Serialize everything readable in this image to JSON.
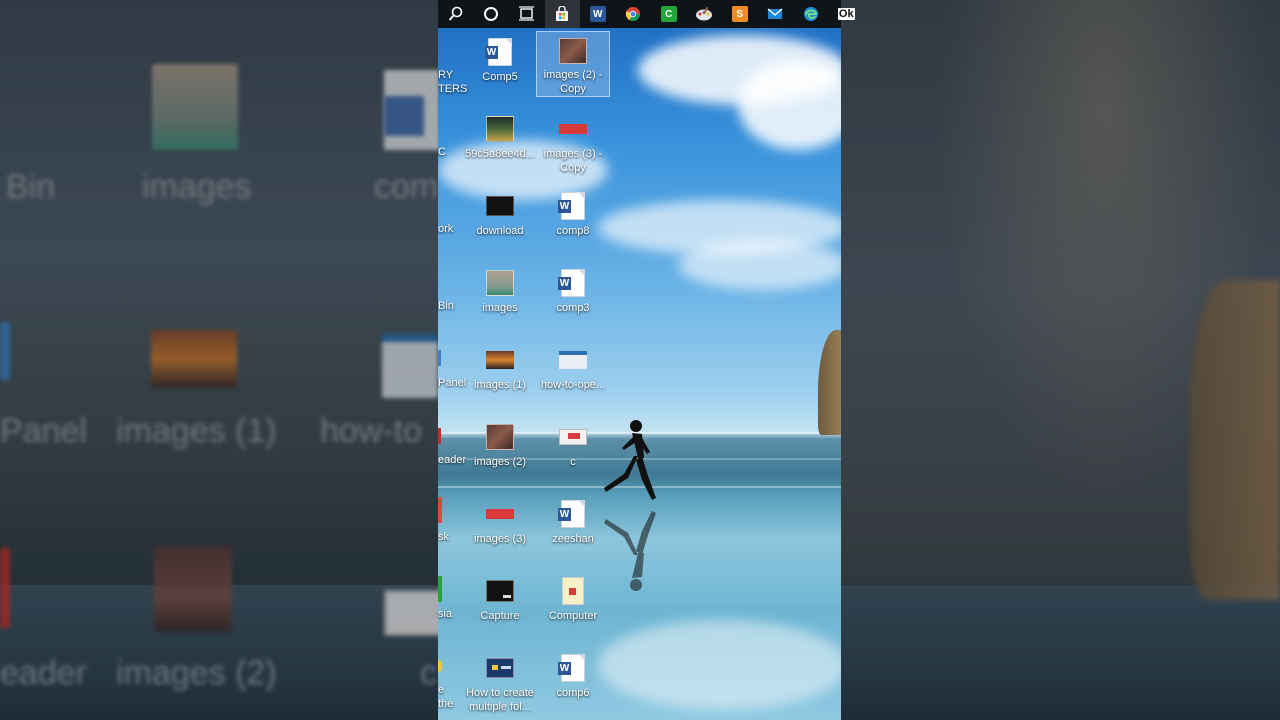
{
  "taskbar": {
    "items": [
      {
        "name": "search"
      },
      {
        "name": "cortana"
      },
      {
        "name": "task-view"
      },
      {
        "name": "store",
        "active": true
      },
      {
        "name": "word"
      },
      {
        "name": "chrome"
      },
      {
        "name": "camtasia"
      },
      {
        "name": "paint"
      },
      {
        "name": "sublime"
      },
      {
        "name": "mail"
      },
      {
        "name": "edge"
      },
      {
        "name": "ok-app",
        "label": "Ok"
      }
    ]
  },
  "desktop": {
    "partial_labels": {
      "row1": "RY\nTERS",
      "row2": "C",
      "row3": "ork",
      "row4": "Bin",
      "row5": "Panel",
      "row6": "eader",
      "row7": "sk",
      "row8": "sia",
      "row9": "e\nthe"
    },
    "icons": [
      {
        "label": "Comp5",
        "kind": "word"
      },
      {
        "label": "images (2) -\nCopy",
        "kind": "photo",
        "selected": true
      },
      {
        "label": "59c5a8ee4d...",
        "kind": "photo"
      },
      {
        "label": "images (3) -\nCopy",
        "kind": "redbar"
      },
      {
        "label": "download",
        "kind": "dark"
      },
      {
        "label": "comp8",
        "kind": "word"
      },
      {
        "label": "images",
        "kind": "photo"
      },
      {
        "label": "comp3",
        "kind": "word"
      },
      {
        "label": "images (1)",
        "kind": "sunset"
      },
      {
        "label": "how-to-ope...",
        "kind": "window"
      },
      {
        "label": "images (2)",
        "kind": "photo"
      },
      {
        "label": "c",
        "kind": "redthumb"
      },
      {
        "label": "images (3)",
        "kind": "redbar"
      },
      {
        "label": "zeeshan",
        "kind": "word"
      },
      {
        "label": "Capture",
        "kind": "dark"
      },
      {
        "label": "Computer",
        "kind": "folderdoc"
      },
      {
        "label": "How to create\nmultiple fol...",
        "kind": "video"
      },
      {
        "label": "comp6",
        "kind": "word"
      }
    ]
  },
  "background_blur": {
    "left_labels": [
      "Bin",
      "images",
      "com",
      "Panel",
      "images (1)",
      "how-to",
      "eader",
      "images (2)",
      "c"
    ]
  },
  "colors": {
    "taskbar": "#0f1418",
    "word_blue": "#2b5797",
    "sky": "#3a93dc"
  }
}
